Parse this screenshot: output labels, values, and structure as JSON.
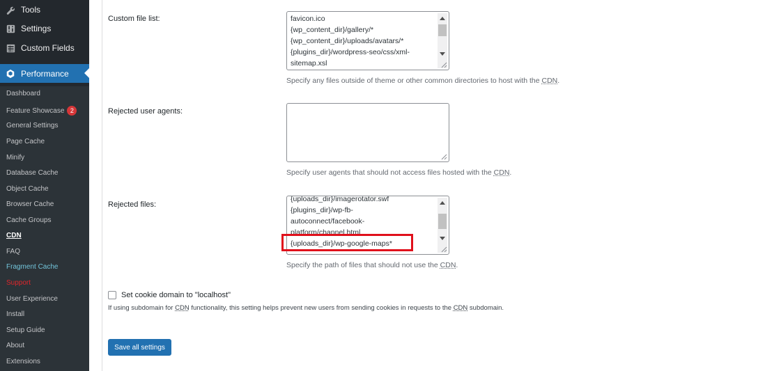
{
  "sidebar": {
    "top_items": [
      {
        "label": "Tools",
        "icon": "wrench-icon"
      },
      {
        "label": "Settings",
        "icon": "settings-icon"
      },
      {
        "label": "Custom Fields",
        "icon": "table-icon"
      }
    ],
    "current": {
      "label": "Performance",
      "icon": "performance-icon"
    },
    "submenu": [
      {
        "label": "Dashboard"
      },
      {
        "label": "Feature Showcase",
        "badge": "2"
      },
      {
        "label": "General Settings"
      },
      {
        "label": "Page Cache"
      },
      {
        "label": "Minify"
      },
      {
        "label": "Database Cache"
      },
      {
        "label": "Object Cache"
      },
      {
        "label": "Browser Cache"
      },
      {
        "label": "Cache Groups"
      },
      {
        "label": "CDN",
        "current": true
      },
      {
        "label": "FAQ"
      },
      {
        "label": "Fragment Cache"
      },
      {
        "label": "Support"
      },
      {
        "label": "User Experience"
      },
      {
        "label": "Install"
      },
      {
        "label": "Setup Guide"
      },
      {
        "label": "About"
      },
      {
        "label": "Extensions"
      }
    ]
  },
  "fields": {
    "custom_file_list": {
      "label": "Custom file list:",
      "lines": [
        "favicon.ico",
        "{wp_content_dir}/gallery/*",
        "{wp_content_dir}/uploads/avatars/*",
        "{plugins_dir}/wordpress-seo/css/xml-",
        "sitemap.xsl"
      ],
      "desc_before": "Specify any files outside of theme or other common directories to host with the ",
      "desc_abbr": "CDN",
      "desc_after": "."
    },
    "rejected_user_agents": {
      "label": "Rejected user agents:",
      "desc_before": "Specify user agents that should not access files hosted with the ",
      "desc_abbr": "CDN",
      "desc_after": "."
    },
    "rejected_files": {
      "label": "Rejected files:",
      "lines": [
        "{uploads_dir}/imagerotator.swf",
        "{plugins_dir}/wp-fb-",
        "autoconnect/facebook-",
        "platform/channel.html",
        "{uploads_dir}/wp-google-maps*"
      ],
      "desc_before": "Specify the path of files that should not use the ",
      "desc_abbr": "CDN",
      "desc_after": "."
    }
  },
  "cookie": {
    "label": "Set cookie domain to \"localhost\"",
    "checked": false,
    "desc_1": "If using subdomain for ",
    "desc_abbr_1": "CDN",
    "desc_2": " functionality, this setting helps prevent new users from sending cookies in requests to the ",
    "desc_abbr_2": "CDN",
    "desc_3": " subdomain."
  },
  "save_button": "Save all settings",
  "colors": {
    "accent": "#2271b1",
    "highlight": "#e0101b",
    "sidebar": "#23282d"
  }
}
